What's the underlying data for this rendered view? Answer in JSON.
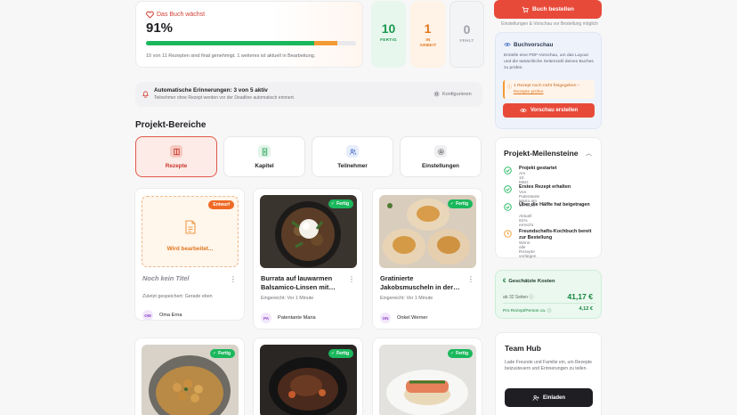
{
  "progress": {
    "heading": "Das Buch wächst",
    "percent": "91%",
    "done_fraction": 0.8,
    "work_fraction": 0.11,
    "summary": "10 von 11 Rezepten sind final genehmigt. 1 weiteres ist aktuell in Bearbeitung."
  },
  "stats": [
    {
      "value": "10",
      "label": "FERTIG"
    },
    {
      "value": "1",
      "label": "IN ARBEIT"
    },
    {
      "value": "0",
      "label": "FEHLT"
    }
  ],
  "reminder": {
    "title": "Automatische Erinnerungen: 3 von 5 aktiv",
    "subtitle": "Teilnehmer ohne Rezept werden vor der Deadline automatisch erinnert.",
    "configure": "Konfigurieren"
  },
  "section_title": "Projekt-Bereiche",
  "tabs": [
    "Rezepte",
    "Kapitel",
    "Teilnehmer",
    "Einstellungen"
  ],
  "recipes": [
    {
      "title": "Noch kein Titel",
      "meta": "Zuletzt gespeichert: Gerade eben",
      "initials": "OM",
      "author": "Oma Erna",
      "badge": "Entwurf",
      "draft_text": "Wird bearbeitet..."
    },
    {
      "title": "Burrata auf lauwarmen Balsamico-Linsen mit…",
      "meta": "Eingereicht: Vor 1 Minute",
      "initials": "PA",
      "author": "Patentante Maria",
      "badge": "Fertig"
    },
    {
      "title": "Gratinierte Jakobsmuscheln in der…",
      "meta": "Eingereicht: Vor 1 Minute",
      "initials": "ON",
      "author": "Onkel Werner",
      "badge": "Fertig"
    },
    {
      "badge": "Fertig"
    },
    {
      "badge": "Fertig"
    },
    {
      "badge": "Fertig"
    }
  ],
  "order": {
    "button": "Buch bestellen",
    "note": "Einstellungen & Vorschau vor Bestellung möglich"
  },
  "preview": {
    "title": "Buchvorschau",
    "desc": "Erstelle eine PDF-Vorschau, um das Layout und die tatsächliche Seitenzahl deines Buches zu prüfen.",
    "warn1": "1 Rezept noch nicht freigegeben –",
    "warn2": "Rezepte prüfen",
    "button": "Vorschau erstellen"
  },
  "milestones": {
    "title": "Projekt-Meilensteine",
    "items": [
      {
        "title": "Projekt gestartet",
        "sub": "Am 10. März",
        "done": true
      },
      {
        "title": "Erstes Rezept erhalten",
        "sub": "Von Patentante Maria am 10. März",
        "done": true
      },
      {
        "title": "Über die Hälfte hat beigetragen",
        "sub": "Aktuell 91% erreicht",
        "done": true
      },
      {
        "title": "Freundschafts-Kochbuch bereit zur Bestellung",
        "sub": "Wenn alle Rezepte vorliegen",
        "done": false
      }
    ]
  },
  "costs": {
    "title": "Geschätzte Kosten",
    "pages_label": "ab 32 Seiten",
    "total": "41,17 €",
    "per_label": "Pro Rezept/Person ca.",
    "per_value": "4,12 €"
  },
  "team": {
    "title": "Team Hub",
    "desc": "Lade Freunde und Familie ein, um Rezepte beizusteuern und Erinnerungen zu teilen.",
    "button": "Einladen"
  },
  "colors": {
    "accent": "#e84a3a",
    "success": "#1bb75c",
    "warning": "#f29a33"
  }
}
